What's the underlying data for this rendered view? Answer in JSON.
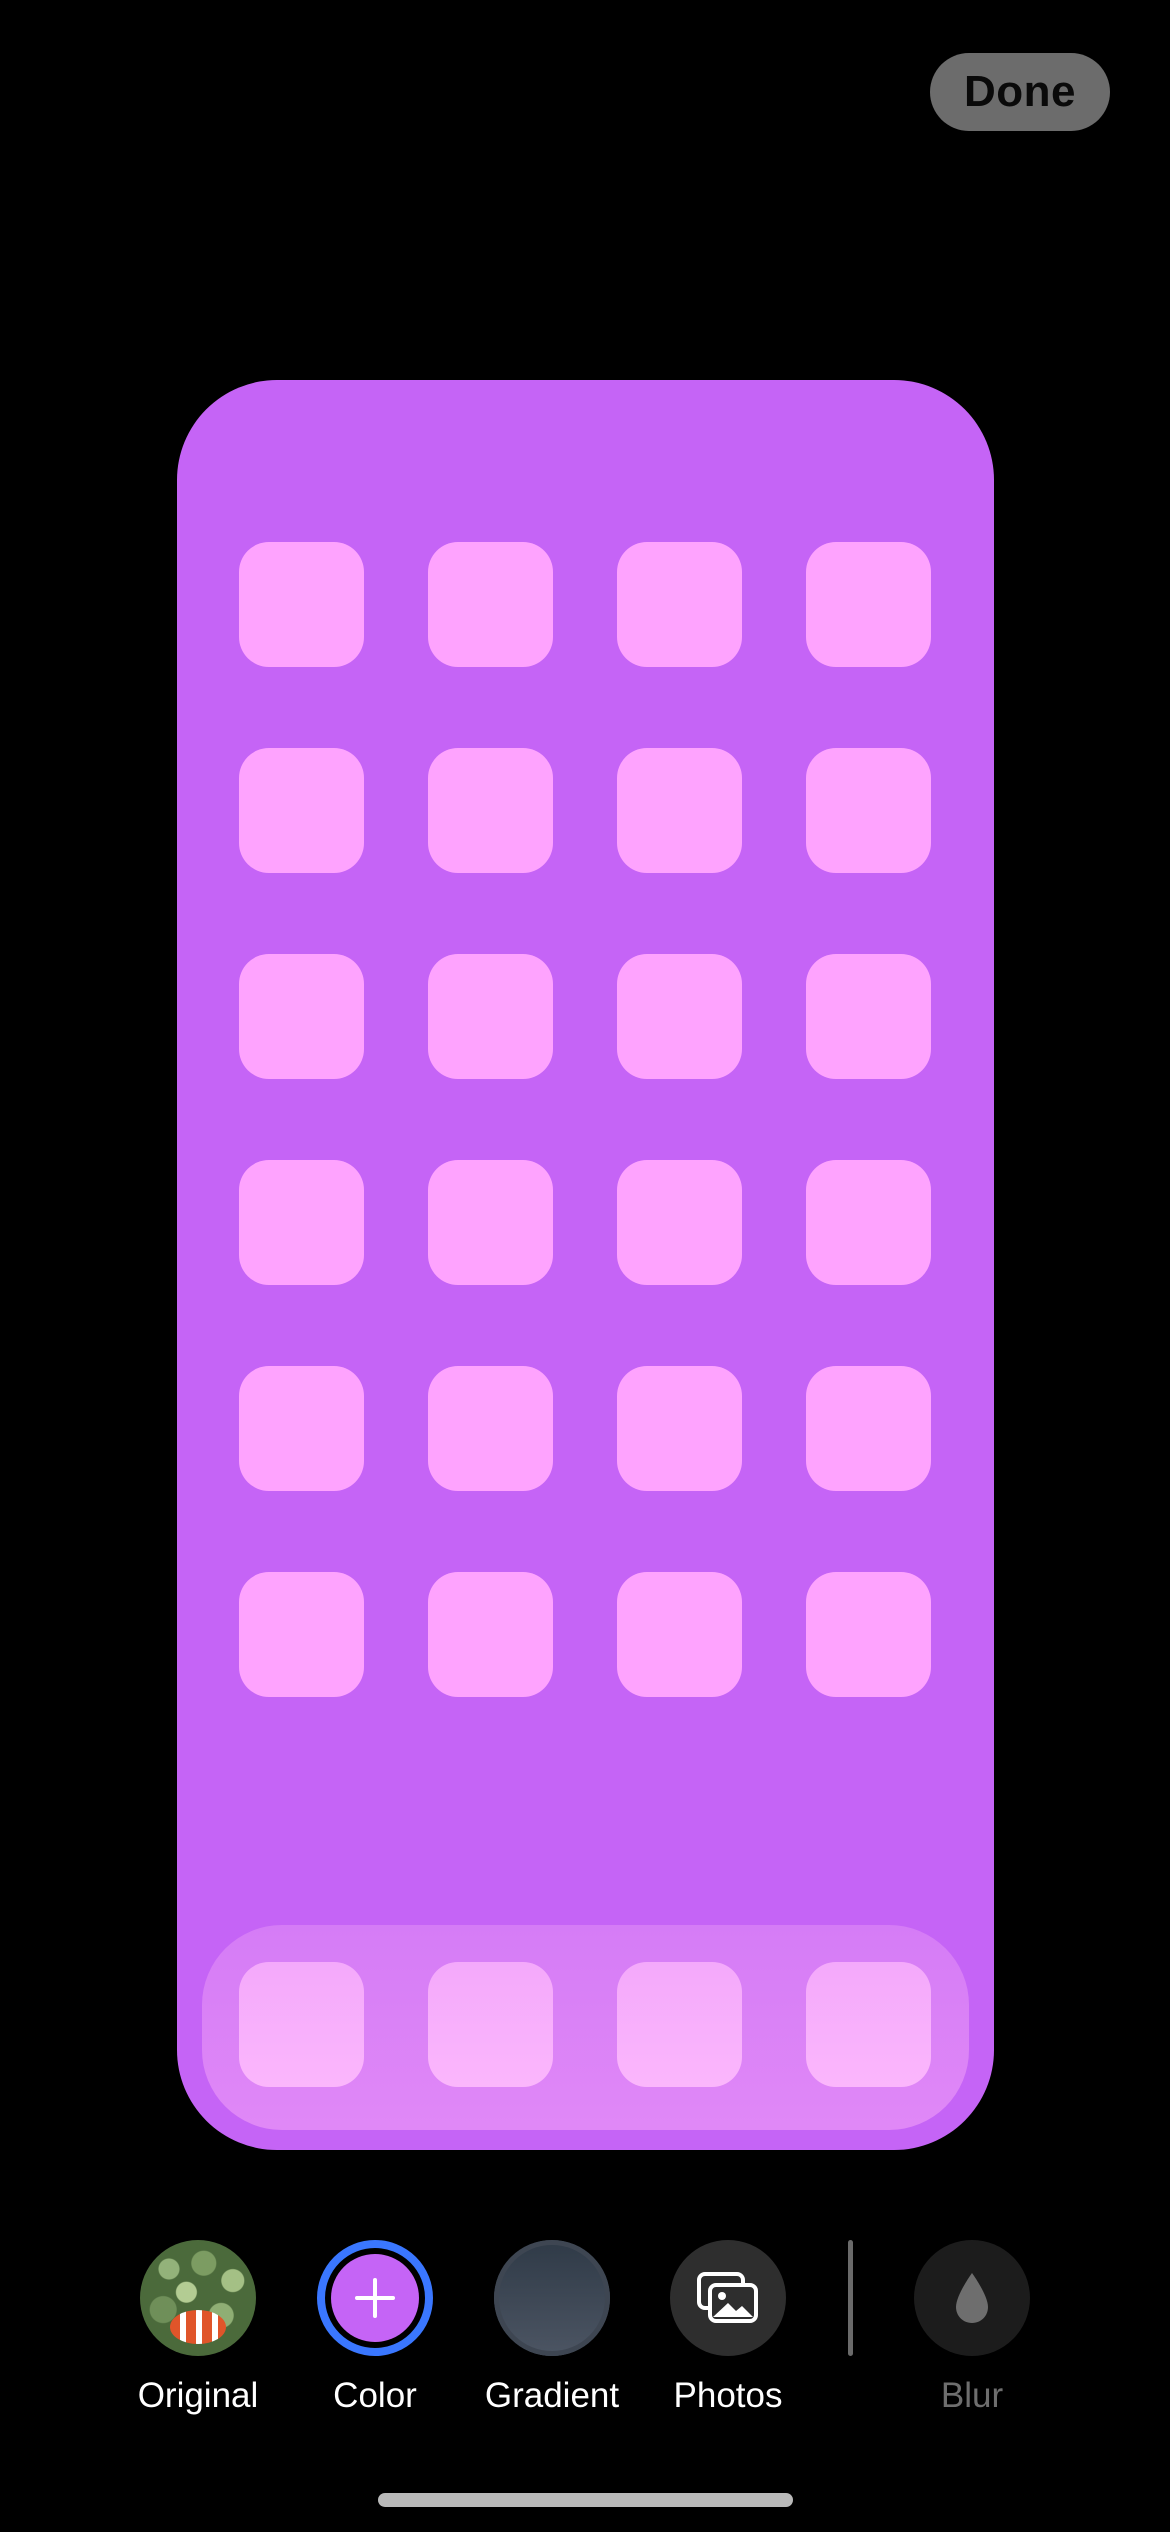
{
  "header": {
    "done_label": "Done"
  },
  "preview": {
    "background_color": "#c564f6",
    "icon_color": "#fea3fe",
    "rows": 6,
    "columns": 4,
    "dock_icons": 4
  },
  "toolbar": {
    "items": [
      {
        "label": "Original",
        "icon": "original-photo-thumbnail",
        "selected": false,
        "enabled": true
      },
      {
        "label": "Color",
        "icon": "plus-icon",
        "selected": true,
        "enabled": true
      },
      {
        "label": "Gradient",
        "icon": "gradient-swatch",
        "selected": false,
        "enabled": true
      },
      {
        "label": "Photos",
        "icon": "photos-icon",
        "selected": false,
        "enabled": true
      },
      {
        "label": "Blur",
        "icon": "drop-icon",
        "selected": false,
        "enabled": false
      }
    ]
  },
  "colors": {
    "accent": "#3a77ff",
    "done_button_bg": "#6c6c6c"
  }
}
